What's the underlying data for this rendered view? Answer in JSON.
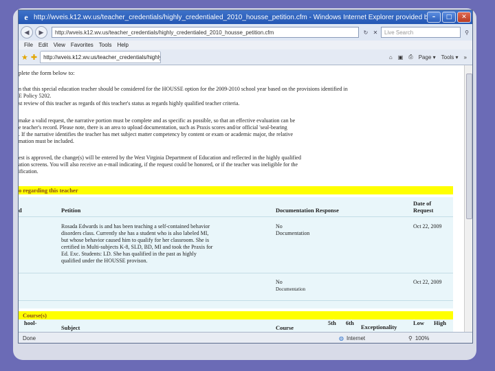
{
  "window": {
    "title": "http://wveis.k12.wv.us/teacher_credentials/highly_credentialed_2010_housse_petition.cfm - Windows Internet Explorer provided by",
    "minimize": "–",
    "maximize": "□",
    "close": "✕"
  },
  "address": {
    "url": "http://wveis.k12.wv.us/teacher_credentials/highly_credentialed_2010_housse_petition.cfm",
    "search_placeholder": "Live Search"
  },
  "menu": [
    "File",
    "Edit",
    "View",
    "Favorites",
    "Tools",
    "Help"
  ],
  "tab": {
    "label": "http://wveis.k12.wv.us/teacher_credentials/highly_cr..."
  },
  "toolbar": {
    "page": "Page ▾",
    "tools": "Tools ▾"
  },
  "page": {
    "intro": "plete the form below to:",
    "lines_1": [
      "n that this special education teacher should be considered for the HOUSSE option for the 2009-2010 school year based on the provisions identified in",
      "E Policy 5202.",
      "st review of this teacher as regards of this teacher's status as regards highly qualified teacher criteria."
    ],
    "lines_2": [
      "make a valid request, the narrative portion must be complete and as specific as possible, so that an effective evaluation can be",
      "e teacher's record.  Please note, there is an area to upload documentation, such as Praxis scores and/or official 'seal-bearing",
      ".  If the narrative identifies the teacher has met subject matter competency by content or exam or academic major, the relative",
      "mation must be included."
    ],
    "lines_3": [
      "est is approved, the change(s) will be entered by the West Virginia Department of Education and reflected in the highly qualified",
      "ation screens.  You will also receive an e-mail indicating, if the request could be honored, or if the teacher was ineligible for the",
      "ification."
    ],
    "band_teacher": "o regarding this teacher",
    "band_courses": "Course(s)"
  },
  "table": {
    "headers": {
      "col_a": "d",
      "petition": "Petition",
      "documentation": "Documentation Response",
      "date_1": "Date of",
      "date_2": "Request"
    },
    "rows": [
      {
        "petition": [
          "Rosada Edwards is and has been teaching a self-contained behavior",
          "disorders class. Currently she has a student who is also labeled MI,",
          "but whose behavior caused him to qualify for her classroom. She is",
          "certified in Multi-subjects K-8, SLD, BD, MI and took the Praxis for",
          "Ed. Exc. Students: LD.  She has qualified in the past as highly",
          "qualified under the HOUSSE provison."
        ],
        "doc": [
          "No",
          "Documentation"
        ],
        "date": "Oct 22, 2009"
      },
      {
        "petition": [],
        "doc": [
          "No",
          "Documentation"
        ],
        "date": "Oct 22, 2009"
      }
    ]
  },
  "courses": {
    "headers": {
      "school": "hool-",
      "subject": "Subject",
      "course": "Course",
      "fifth": "5th",
      "sixth": "6th",
      "exceptionality": "Exceptionality",
      "low": "Low",
      "high": "High"
    }
  },
  "status": {
    "left": "Done",
    "zone": "Internet",
    "zoom": "100%"
  },
  "colors": {
    "slide_bg": "#6b6bb6",
    "band_yellow": "#ffff00",
    "table_bg": "#e9f6fa"
  }
}
